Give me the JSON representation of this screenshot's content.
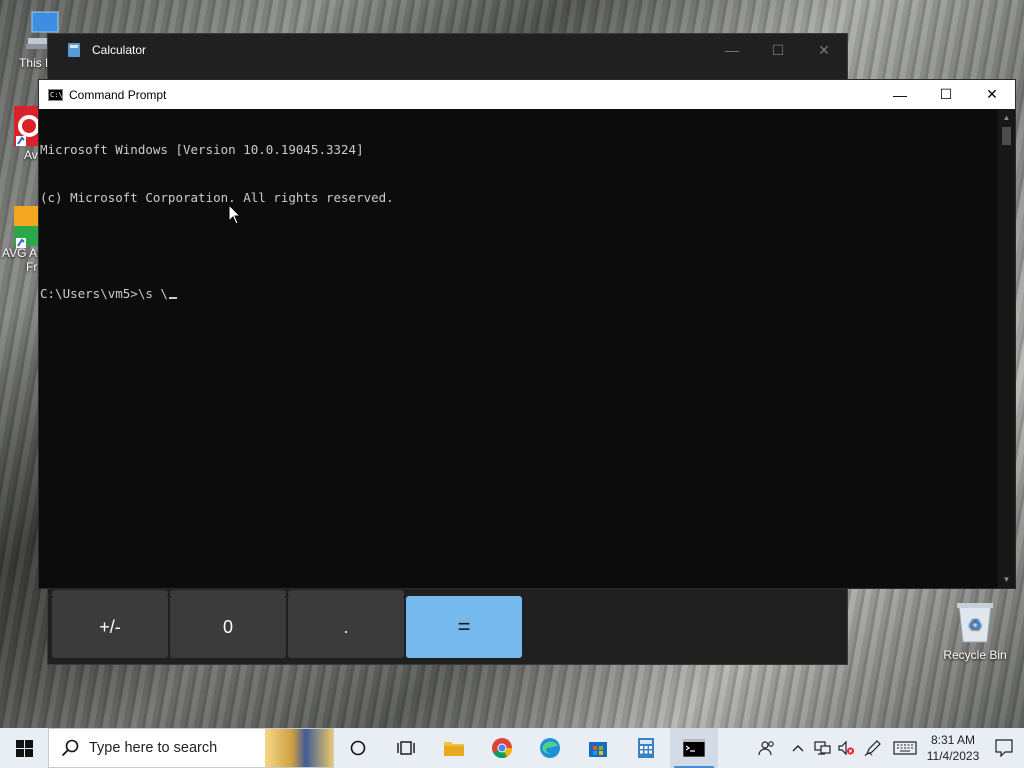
{
  "desktop": {
    "icons": [
      {
        "label": "This P",
        "glyph": "monitor-icon"
      },
      {
        "label": "Av",
        "glyph": "avast-icon"
      },
      {
        "label": "AVG Ar Fr",
        "line1": "AVG Ar",
        "line2": "Fr",
        "glyph": "avg-icon"
      },
      {
        "label": "Recycle Bin",
        "glyph": "recycle-bin-icon"
      }
    ]
  },
  "calculator": {
    "title": "Calculator",
    "controls": {
      "minimize": "—",
      "maximize": "☐",
      "close": "✕"
    },
    "keys": [
      "+/-",
      "0",
      ".",
      "="
    ],
    "colors": {
      "equals": "#76b9ed",
      "key": "#3b3b3b"
    }
  },
  "cmd": {
    "title": "Command Prompt",
    "icon_text": "C:\\",
    "controls": {
      "minimize": "—",
      "maximize": "☐",
      "close": "✕"
    },
    "lines": [
      "Microsoft Windows [Version 10.0.19045.3324]",
      "(c) Microsoft Corporation. All rights reserved.",
      "",
      "C:\\Users\\vm5>\\s \\"
    ]
  },
  "taskbar": {
    "search_placeholder": "Type here to search",
    "pinned": [
      "cortana-icon",
      "task-view-icon",
      "file-explorer-icon",
      "chrome-icon",
      "edge-icon",
      "store-icon",
      "calculator-icon",
      "command-prompt-icon"
    ],
    "active": "command-prompt-icon",
    "clock": {
      "time": "8:31 AM",
      "date": "11/4/2023"
    }
  }
}
